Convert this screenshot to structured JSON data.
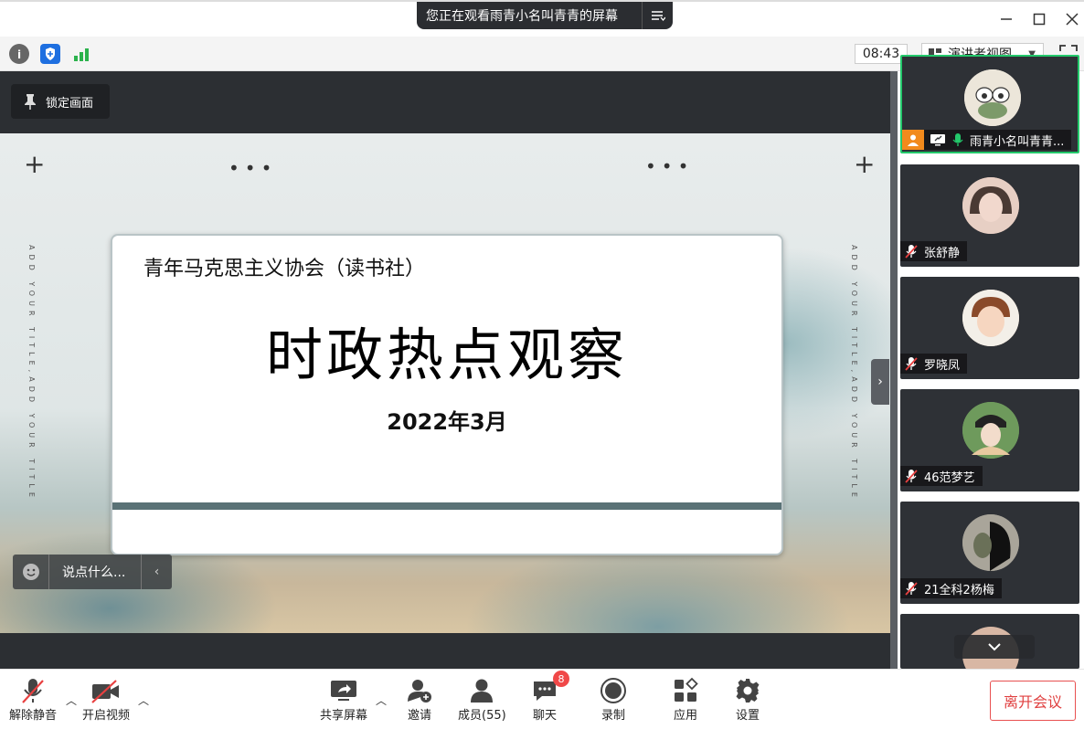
{
  "titlebar": {
    "banner_text": "您正在观看雨青小名叫青青的屏幕"
  },
  "toolbar": {
    "clock": "08:43",
    "view_label": "演讲者视图"
  },
  "stage": {
    "lock_label": "锁定画面",
    "chat_placeholder": "说点什么..."
  },
  "slide": {
    "org": "青年马克思主义协会（读书社）",
    "title": "时政热点观察",
    "date": "2022年3月",
    "side_text_left": "ADD YOUR TITLE,ADD YOUR TITLE",
    "side_text_right": "ADD YOUR TITLE,ADD YOUR TITLE"
  },
  "participants": [
    {
      "name": "雨青小名叫青青...",
      "active": true,
      "avatar_color": "#d9d2c4"
    },
    {
      "name": "张舒静",
      "active": false,
      "avatar_color": "#c49a8a"
    },
    {
      "name": "罗晓凤",
      "active": false,
      "avatar_color": "#e8c2a8"
    },
    {
      "name": "46范梦艺",
      "active": false,
      "avatar_color": "#5f8a52"
    },
    {
      "name": "21全科2杨梅",
      "active": false,
      "avatar_color": "#7d7a72"
    }
  ],
  "bottombar": {
    "unmute": "解除静音",
    "start_video": "开启视频",
    "share_screen": "共享屏幕",
    "invite": "邀请",
    "members": "成员(55)",
    "chat": "聊天",
    "chat_badge": "8",
    "record": "录制",
    "apps": "应用",
    "settings": "设置",
    "leave": "离开会议"
  },
  "colors": {
    "accent_green": "#23c86b",
    "danger_red": "#e04040",
    "stage_dark": "#2c2f33"
  }
}
